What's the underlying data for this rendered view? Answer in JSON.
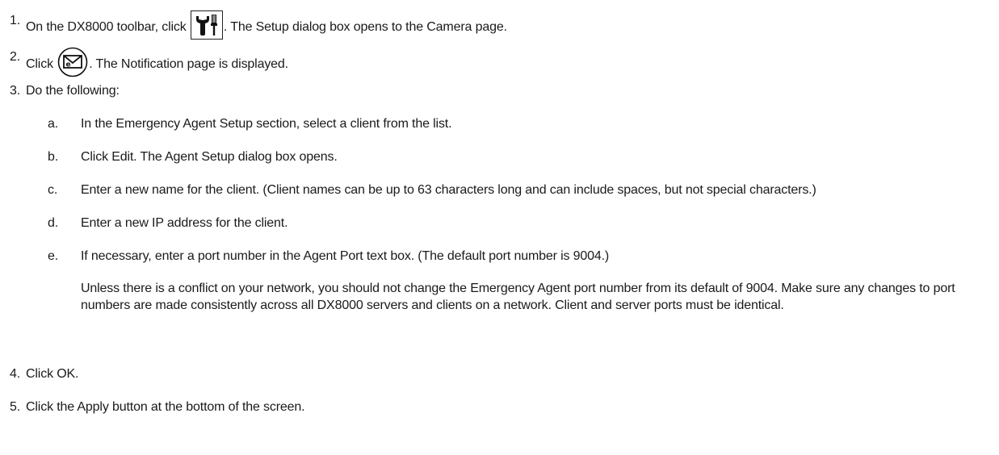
{
  "steps": [
    {
      "num": "1.",
      "before": "On the DX8000 toolbar, click",
      "icon": "setup-tools-icon",
      "after": ". The Setup dialog box opens to the Camera page."
    },
    {
      "num": "2.",
      "before": "Click",
      "icon": "notification-email-icon",
      "after": ". The Notification page is displayed."
    },
    {
      "num": "3.",
      "text": "Do the following:"
    },
    {
      "num": "4.",
      "text": "Click OK."
    },
    {
      "num": "5.",
      "text": "Click the Apply button at the bottom of the screen."
    }
  ],
  "substeps": [
    {
      "letter": "a.",
      "text": "In the Emergency Agent Setup section, select a client from the list."
    },
    {
      "letter": "b.",
      "text": "Click Edit. The Agent Setup dialog box opens."
    },
    {
      "letter": "c.",
      "text": "Enter a new name for the client. (Client names can be up to 63 characters long and can include spaces, but not special characters.)"
    },
    {
      "letter": "d.",
      "text": "Enter a new IP address for the client."
    },
    {
      "letter": "e.",
      "text": "If necessary, enter a port number in the Agent Port text box. (The default port number is 9004.)"
    }
  ],
  "note": "Unless there is a conflict on your network, you should not change the Emergency Agent port number from its default of 9004. Make sure any changes to port numbers are made consistently across all DX8000 servers and clients on a network. Client and server ports must be identical."
}
